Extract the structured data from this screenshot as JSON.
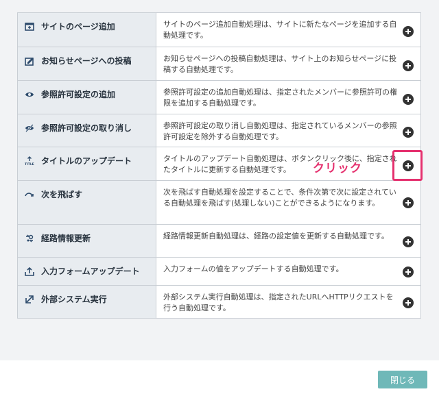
{
  "rows": [
    {
      "name": "サイトのページ追加",
      "icon": "page-add-icon",
      "desc": "サイトのページ追加自動処理は、サイトに新たなページを追加する自動処理です。"
    },
    {
      "name": "お知らせページへの投稿",
      "icon": "notice-post-icon",
      "desc": "お知らせページへの投稿自動処理は、サイト上のお知らせページに投稿する自動処理です。"
    },
    {
      "name": "参照許可設定の追加",
      "icon": "eye-icon",
      "desc": "参照許可設定の追加自動処理は、指定されたメンバーに参照許可の権限を追加する自動処理です。"
    },
    {
      "name": "参照許可設定の取り消し",
      "icon": "eye-slash-icon",
      "desc": "参照許可設定の取り消し自動処理は、指定されているメンバーの参照許可設定を除外する自動処理です。"
    },
    {
      "name": "タイトルのアップデート",
      "icon": "title-update-icon",
      "desc": "タイトルのアップデート自動処理は、ボタンクリック後に、指定されたタイトルに更新する自動処理です。"
    },
    {
      "name": "次を飛ばす",
      "icon": "skip-icon",
      "desc": "次を飛ばす自動処理を設定することで、条件次第で次に設定されている自動処理を飛ばす(処理しない)ことができるようになります。"
    },
    {
      "name": "経路情報更新",
      "icon": "route-update-icon",
      "desc": "経路情報更新自動処理は、経路の設定値を更新する自動処理です。"
    },
    {
      "name": "入力フォームアップデート",
      "icon": "form-upload-icon",
      "desc": "入力フォームの値をアップデートする自動処理です。"
    },
    {
      "name": "外部システム実行",
      "icon": "external-link-icon",
      "desc": "外部システム実行自動処理は、指定されたURLへHTTPリクエストを行う自動処理です。"
    }
  ],
  "annotation": "クリック",
  "close_label": "閉じる",
  "colors": {
    "accent": "#e5306e",
    "close": "#6fb8b8",
    "name_bg": "#e8ecf0"
  }
}
